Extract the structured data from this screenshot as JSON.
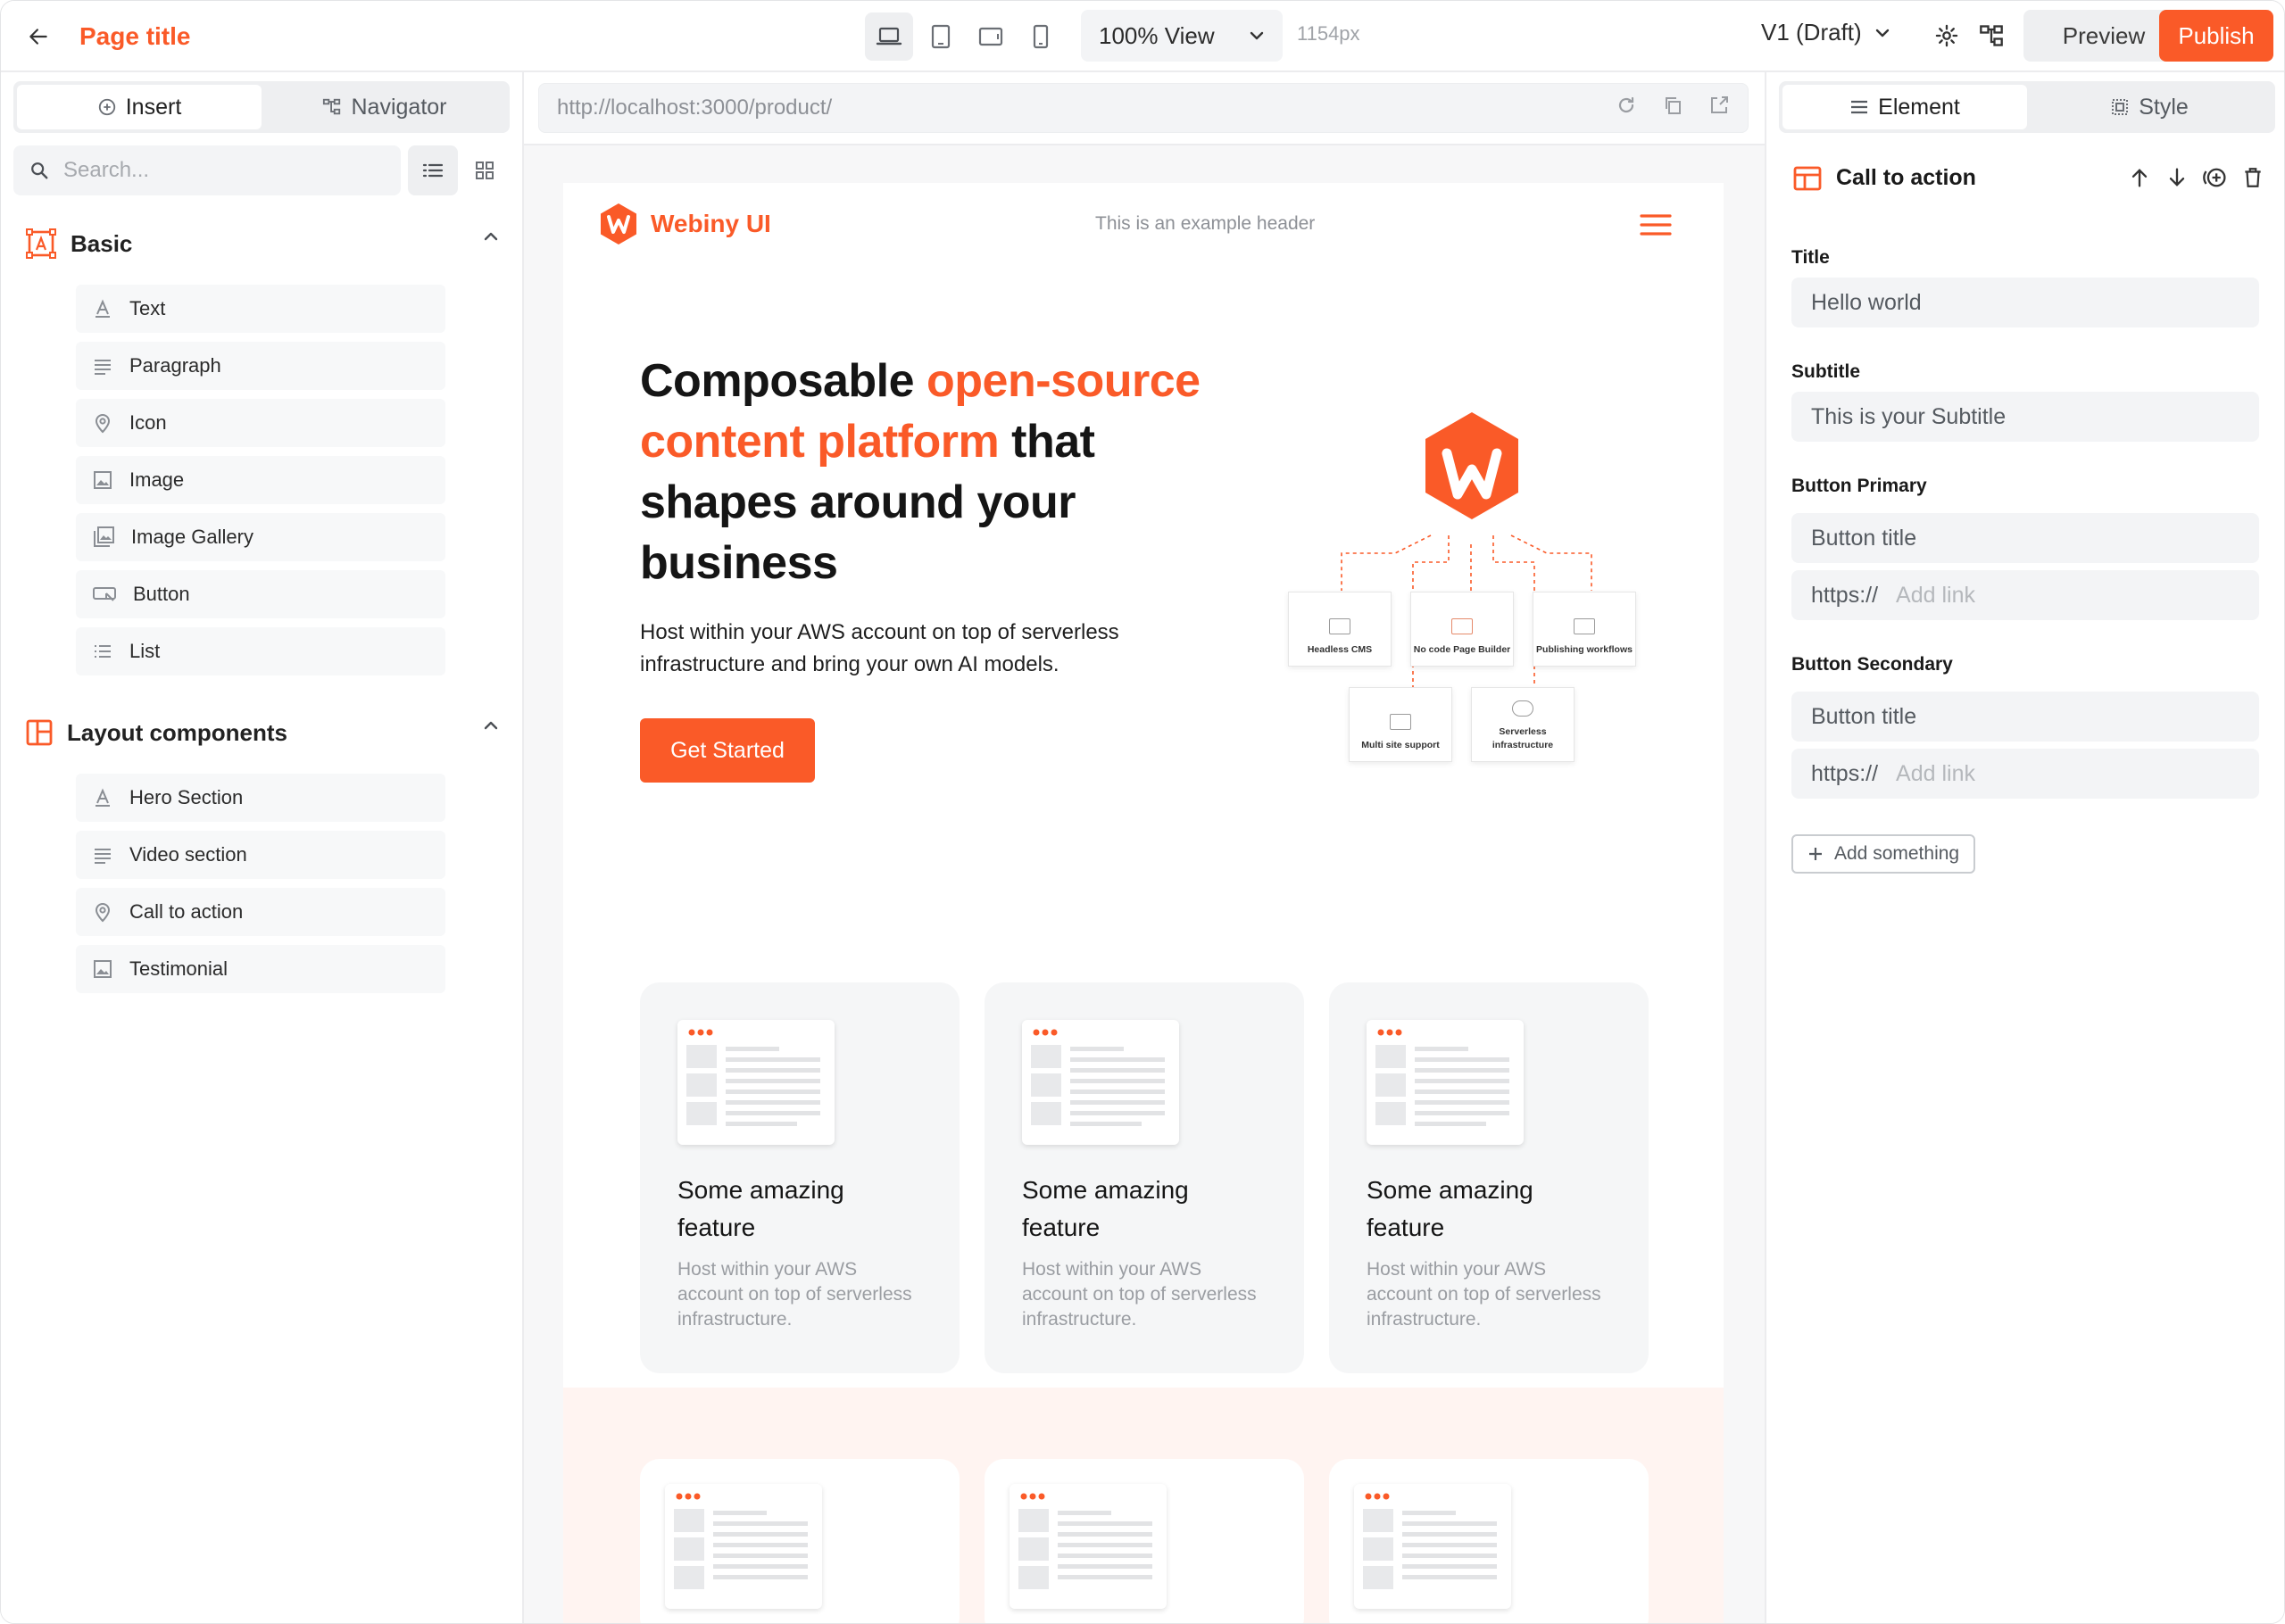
{
  "topbar": {
    "page_title": "Page title",
    "zoom_label": "100% View",
    "width_readout": "1154px",
    "version_label": "V1 (Draft)",
    "preview_label": "Preview",
    "publish_label": "Publish",
    "devices": [
      "laptop-icon",
      "tablet-icon",
      "tablet-landscape-icon",
      "mobile-icon"
    ]
  },
  "sidebar": {
    "tabs": [
      {
        "label": "Insert",
        "icon": "plus-circle-icon",
        "active": true
      },
      {
        "label": "Navigator",
        "icon": "tree-icon",
        "active": false
      }
    ],
    "search_placeholder": "Search...",
    "groups": [
      {
        "title": "Basic",
        "icon": "text-box-icon",
        "items": [
          {
            "label": "Text",
            "icon": "text-icon"
          },
          {
            "label": "Paragraph",
            "icon": "paragraph-icon"
          },
          {
            "label": "Icon",
            "icon": "pin-icon"
          },
          {
            "label": "Image",
            "icon": "image-icon"
          },
          {
            "label": "Image Gallery",
            "icon": "gallery-icon"
          },
          {
            "label": "Button",
            "icon": "button-icon"
          },
          {
            "label": "List",
            "icon": "list-icon"
          }
        ]
      },
      {
        "title": "Layout components",
        "icon": "layout-icon",
        "items": [
          {
            "label": "Hero Section",
            "icon": "text-icon"
          },
          {
            "label": "Video section",
            "icon": "paragraph-icon"
          },
          {
            "label": "Call to action",
            "icon": "pin-icon"
          },
          {
            "label": "Testimonial",
            "icon": "image-icon"
          }
        ]
      }
    ]
  },
  "canvas": {
    "url": "http://localhost:3000/product/",
    "site": {
      "logo_text": "Webiny UI",
      "header_text": "This is an example header",
      "hero_title_start": "Composable ",
      "hero_title_highlight": "open-source content platform",
      "hero_title_end": " that shapes around your business",
      "hero_subtitle": "Host within your AWS account on top of serverless infrastructure and bring your own AI models.",
      "hero_button": "Get Started",
      "diagram_labels": [
        "Headless CMS",
        "No code Page Builder",
        "Publishing workflows",
        "Multi site support",
        "Serverless infrastructure"
      ],
      "features": [
        {
          "title": "Some amazing feature",
          "text": "Host within your AWS account on top of serverless infrastructure."
        },
        {
          "title": "Some amazing feature",
          "text": "Host within your AWS account on top of serverless infrastructure."
        },
        {
          "title": "Some amazing feature",
          "text": "Host within your AWS account on top of serverless infrastructure."
        }
      ]
    }
  },
  "panel": {
    "tabs": [
      {
        "label": "Element",
        "icon": "lines-icon",
        "active": true
      },
      {
        "label": "Style",
        "icon": "style-icon",
        "active": false
      }
    ],
    "element_name": "Call to action",
    "fields": {
      "title_label": "Title",
      "title_value": "Hello world",
      "subtitle_label": "Subtitle",
      "subtitle_value": "This is your Subtitle",
      "primary_label": "Button Primary",
      "primary_button_placeholder": "Button title",
      "primary_link_prefix": "https://",
      "primary_link_placeholder": "Add link",
      "secondary_label": "Button Secondary",
      "secondary_button_placeholder": "Button title",
      "secondary_link_prefix": "https://",
      "secondary_link_placeholder": "Add link"
    },
    "add_button": "Add something"
  },
  "colors": {
    "accent": "#fa5a28",
    "panel_bg": "#f3f4f6",
    "border": "#ececee"
  }
}
